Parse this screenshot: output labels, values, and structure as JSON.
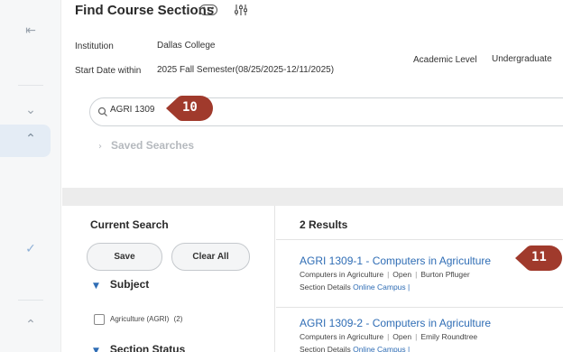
{
  "header": {
    "title": "Find Course Sections",
    "more_icon": "ellipsis-icon",
    "filter_icon": "sliders-icon"
  },
  "criteria": {
    "institution_label": "Institution",
    "institution_value": "Dallas College",
    "start_date_label": "Start Date within",
    "start_date_value": "2025 Fall Semester(08/25/2025-12/11/2025)",
    "academic_level_label": "Academic Level",
    "academic_level_value": "Undergraduate"
  },
  "search": {
    "value": "AGRI 1309",
    "icon": "search-icon"
  },
  "saved_searches": {
    "label": "Saved Searches"
  },
  "current_search": {
    "title": "Current Search",
    "save_label": "Save",
    "clear_label": "Clear All",
    "facets": [
      {
        "label": "Subject",
        "options": [
          {
            "label": "Agriculture (AGRI)",
            "count": "(2)"
          }
        ]
      },
      {
        "label": "Section Status"
      }
    ]
  },
  "results": {
    "count_label": "2 Results",
    "items": [
      {
        "title": "AGRI 1309-1 - Computers in Agriculture",
        "course": "Computers in Agriculture",
        "status": "Open",
        "instructor": "Burton Pfluger",
        "details_label": "Section Details",
        "location": "Online Campus |"
      },
      {
        "title": "AGRI 1309-2 - Computers in Agriculture",
        "course": "Computers in Agriculture",
        "status": "Open",
        "instructor": "Emily Roundtree",
        "details_label": "Section Details",
        "location": "Online Campus |"
      }
    ]
  },
  "callouts": [
    {
      "number": "10"
    },
    {
      "number": "11"
    }
  ],
  "colors": {
    "accent": "#2f6db5",
    "callout": "#a03a2c",
    "rail_bg": "#f6f7f8",
    "band": "#ececec"
  },
  "rail_icons": [
    "collapse-left-icon",
    "chevron-down-icon",
    "chevron-up-icon",
    "check-icon",
    "chevron-up-icon"
  ]
}
